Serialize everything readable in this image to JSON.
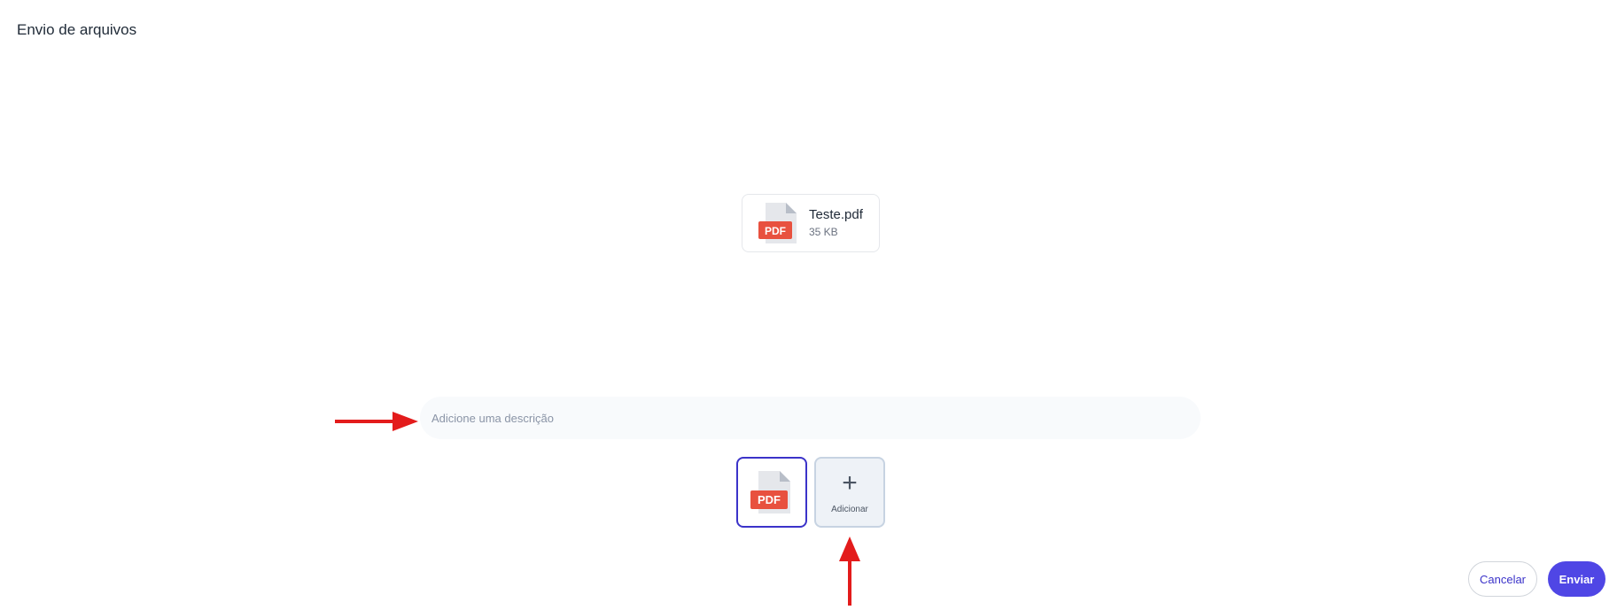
{
  "header": {
    "title": "Envio de arquivos"
  },
  "preview": {
    "file_name": "Teste.pdf",
    "file_size": "35 KB",
    "badge": "PDF"
  },
  "description": {
    "placeholder": "Adicione uma descrição",
    "value": ""
  },
  "thumbnails": {
    "pdf_badge": "PDF",
    "add_label": "Adicionar",
    "add_symbol": "+"
  },
  "actions": {
    "cancel_label": "Cancelar",
    "send_label": "Enviar"
  },
  "colors": {
    "accent": "#4f46e5",
    "selected_border": "#3b33c9",
    "pdf_red": "#e8513f",
    "annotation_arrow": "#e31b1b"
  },
  "icons": {
    "file": "pdf-file-icon",
    "add": "plus-icon"
  }
}
